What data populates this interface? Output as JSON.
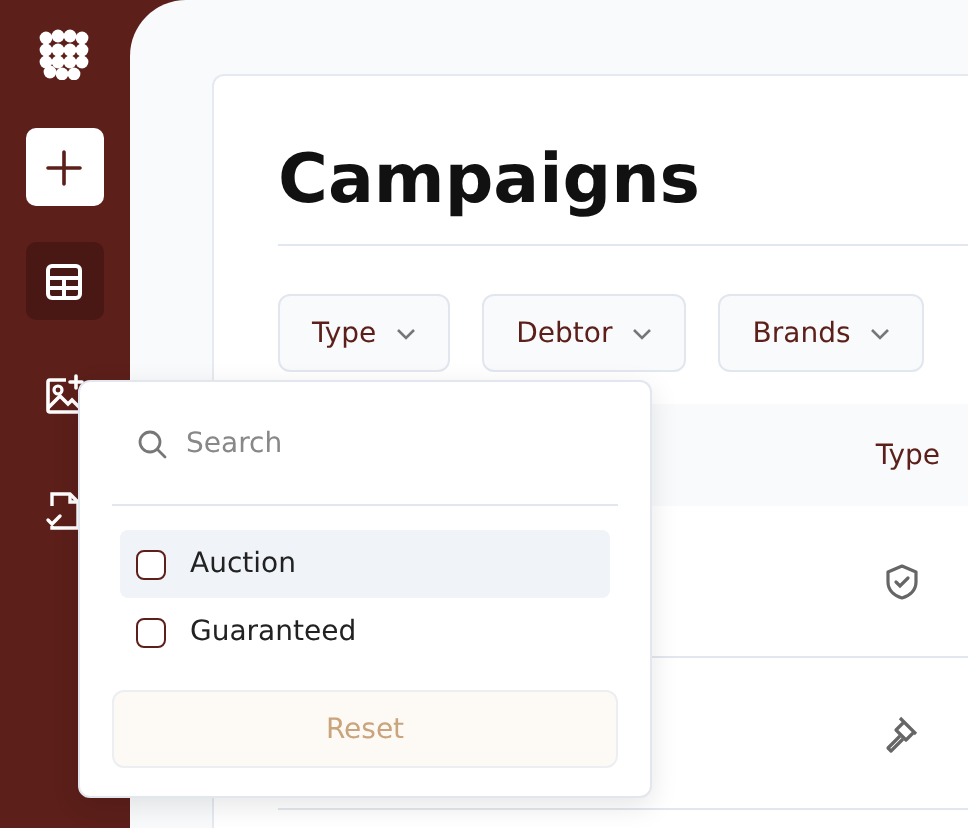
{
  "sidebar": {
    "items": [
      {
        "kind": "table",
        "selected": true
      },
      {
        "kind": "image",
        "selected": false
      },
      {
        "kind": "file",
        "selected": false
      }
    ]
  },
  "page": {
    "title": "Campaigns"
  },
  "filters": [
    {
      "label": "Type"
    },
    {
      "label": "Debtor"
    },
    {
      "label": "Brands"
    }
  ],
  "table": {
    "columns": [
      "Type"
    ],
    "rows": [
      {
        "kind": "guaranteed"
      },
      {
        "kind": "auction"
      }
    ]
  },
  "dropdown": {
    "search": {
      "placeholder": "Search"
    },
    "options": [
      {
        "label": "Auction",
        "checked": false,
        "highlighted": true
      },
      {
        "label": "Guaranteed",
        "checked": false,
        "highlighted": false
      }
    ],
    "reset": {
      "label": "Reset",
      "disabled": true
    }
  }
}
